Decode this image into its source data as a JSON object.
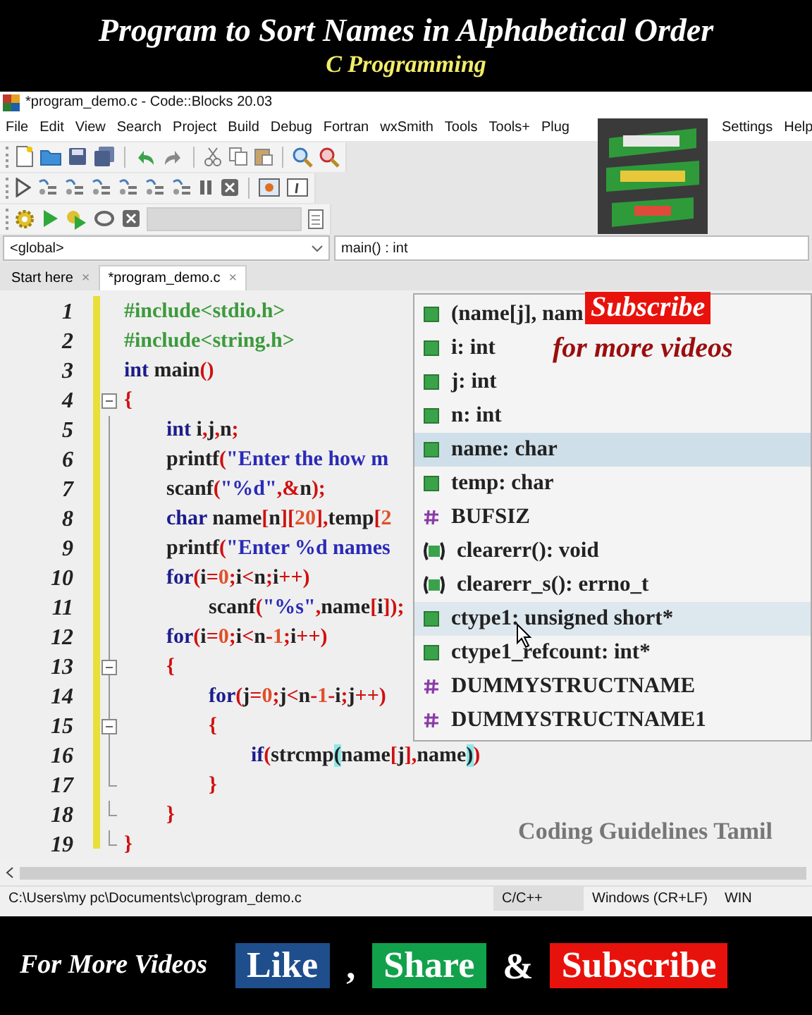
{
  "banner": {
    "title": "Program to Sort Names in Alphabetical Order",
    "subtitle": "C Programming"
  },
  "window": {
    "title": "*program_demo.c - Code::Blocks 20.03",
    "menu": [
      "File",
      "Edit",
      "View",
      "Search",
      "Project",
      "Build",
      "Debug",
      "Fortran",
      "wxSmith",
      "Tools",
      "Tools+",
      "Plug",
      "Settings",
      "Help"
    ],
    "scope": {
      "left": "<global>",
      "right": "main() : int"
    },
    "tabs": [
      {
        "label": "Start here",
        "close": "×",
        "selected": false
      },
      {
        "label": "*program_demo.c",
        "close": "×",
        "selected": true
      }
    ],
    "editor": {
      "lines": [
        {
          "number": "1",
          "kind": "plain",
          "tokens": [
            {
              "kind": "pre",
              "text": "#include<stdio.h>"
            }
          ]
        },
        {
          "number": "2",
          "kind": "plain",
          "tokens": [
            {
              "kind": "pre",
              "text": "#include<string.h>"
            }
          ]
        },
        {
          "number": "3",
          "kind": "plain",
          "tokens": [
            {
              "kind": "kw",
              "text": "int"
            },
            {
              "kind": "id",
              "text": " main"
            },
            {
              "kind": "op",
              "text": "()"
            }
          ]
        },
        {
          "number": "4",
          "kind": "fold_start",
          "tokens": [
            {
              "kind": "op",
              "text": "{"
            }
          ]
        },
        {
          "number": "5",
          "kind": "plain",
          "tokens": [
            {
              "kind": "kw",
              "text": "\tint"
            },
            {
              "kind": "id",
              "text": " i"
            },
            {
              "kind": "op",
              "text": ","
            },
            {
              "kind": "id",
              "text": "j"
            },
            {
              "kind": "op",
              "text": ","
            },
            {
              "kind": "id",
              "text": "n"
            },
            {
              "kind": "op",
              "text": ";"
            }
          ]
        },
        {
          "number": "6",
          "kind": "plain",
          "tokens": [
            {
              "kind": "id",
              "text": "\tprintf"
            },
            {
              "kind": "op",
              "text": "("
            },
            {
              "kind": "str",
              "text": "\"Enter the how m"
            }
          ]
        },
        {
          "number": "7",
          "kind": "plain",
          "tokens": [
            {
              "kind": "id",
              "text": "\tscanf"
            },
            {
              "kind": "op",
              "text": "("
            },
            {
              "kind": "str",
              "text": "\"%d\""
            },
            {
              "kind": "op",
              "text": ",&"
            },
            {
              "kind": "id",
              "text": "n"
            },
            {
              "kind": "op",
              "text": ");"
            }
          ]
        },
        {
          "number": "8",
          "kind": "plain",
          "tokens": [
            {
              "kind": "kw",
              "text": "\tchar"
            },
            {
              "kind": "id",
              "text": " name"
            },
            {
              "kind": "op",
              "text": "["
            },
            {
              "kind": "id",
              "text": "n"
            },
            {
              "kind": "op",
              "text": "]["
            },
            {
              "kind": "num",
              "text": "20"
            },
            {
              "kind": "op",
              "text": "],"
            },
            {
              "kind": "id",
              "text": "temp"
            },
            {
              "kind": "op",
              "text": "["
            },
            {
              "kind": "num",
              "text": "2"
            }
          ]
        },
        {
          "number": "9",
          "kind": "plain",
          "tokens": [
            {
              "kind": "id",
              "text": "\tprintf"
            },
            {
              "kind": "op",
              "text": "("
            },
            {
              "kind": "str",
              "text": "\"Enter %d names"
            }
          ]
        },
        {
          "number": "10",
          "kind": "plain",
          "tokens": [
            {
              "kind": "kw",
              "text": "\tfor"
            },
            {
              "kind": "op",
              "text": "("
            },
            {
              "kind": "id",
              "text": "i"
            },
            {
              "kind": "op",
              "text": "="
            },
            {
              "kind": "num",
              "text": "0"
            },
            {
              "kind": "op",
              "text": ";"
            },
            {
              "kind": "id",
              "text": "i"
            },
            {
              "kind": "op",
              "text": "<"
            },
            {
              "kind": "id",
              "text": "n"
            },
            {
              "kind": "op",
              "text": ";"
            },
            {
              "kind": "id",
              "text": "i"
            },
            {
              "kind": "op",
              "text": "++)"
            }
          ]
        },
        {
          "number": "11",
          "kind": "plain",
          "tokens": [
            {
              "kind": "id",
              "text": "\t\tscanf"
            },
            {
              "kind": "op",
              "text": "("
            },
            {
              "kind": "str",
              "text": "\"%s\""
            },
            {
              "kind": "op",
              "text": ","
            },
            {
              "kind": "id",
              "text": "name"
            },
            {
              "kind": "op",
              "text": "["
            },
            {
              "kind": "id",
              "text": "i"
            },
            {
              "kind": "op",
              "text": "]);"
            }
          ]
        },
        {
          "number": "12",
          "kind": "plain",
          "tokens": [
            {
              "kind": "kw",
              "text": "\tfor"
            },
            {
              "kind": "op",
              "text": "("
            },
            {
              "kind": "id",
              "text": "i"
            },
            {
              "kind": "op",
              "text": "="
            },
            {
              "kind": "num",
              "text": "0"
            },
            {
              "kind": "op",
              "text": ";"
            },
            {
              "kind": "id",
              "text": "i"
            },
            {
              "kind": "op",
              "text": "<"
            },
            {
              "kind": "id",
              "text": "n"
            },
            {
              "kind": "op",
              "text": "-"
            },
            {
              "kind": "num",
              "text": "1"
            },
            {
              "kind": "op",
              "text": ";"
            },
            {
              "kind": "id",
              "text": "i"
            },
            {
              "kind": "op",
              "text": "++)"
            }
          ]
        },
        {
          "number": "13",
          "kind": "fold_start",
          "tokens": [
            {
              "kind": "op",
              "text": "\t{"
            }
          ]
        },
        {
          "number": "14",
          "kind": "plain",
          "tokens": [
            {
              "kind": "kw",
              "text": "\t\tfor"
            },
            {
              "kind": "op",
              "text": "("
            },
            {
              "kind": "id",
              "text": "j"
            },
            {
              "kind": "op",
              "text": "="
            },
            {
              "kind": "num",
              "text": "0"
            },
            {
              "kind": "op",
              "text": ";"
            },
            {
              "kind": "id",
              "text": "j"
            },
            {
              "kind": "op",
              "text": "<"
            },
            {
              "kind": "id",
              "text": "n"
            },
            {
              "kind": "op",
              "text": "-"
            },
            {
              "kind": "num",
              "text": "1"
            },
            {
              "kind": "op",
              "text": "-"
            },
            {
              "kind": "id",
              "text": "i"
            },
            {
              "kind": "op",
              "text": ";"
            },
            {
              "kind": "id",
              "text": "j"
            },
            {
              "kind": "op",
              "text": "++)"
            }
          ]
        },
        {
          "number": "15",
          "kind": "fold_start",
          "tokens": [
            {
              "kind": "op",
              "text": "\t\t{"
            }
          ]
        },
        {
          "number": "16",
          "kind": "plain",
          "tokens": [
            {
              "kind": "kw",
              "text": "\t\t\tif"
            },
            {
              "kind": "op",
              "text": "("
            },
            {
              "kind": "id",
              "text": "strcmp"
            },
            {
              "kind": "match",
              "text": "("
            },
            {
              "kind": "id",
              "text": "name"
            },
            {
              "kind": "op",
              "text": "["
            },
            {
              "kind": "id",
              "text": "j"
            },
            {
              "kind": "op",
              "text": "],"
            },
            {
              "kind": "id",
              "text": "name"
            },
            {
              "kind": "match",
              "text": ")"
            },
            {
              "kind": "op",
              "text": ")"
            }
          ]
        },
        {
          "number": "17",
          "kind": "fold_end",
          "tokens": [
            {
              "kind": "op",
              "text": "\t\t}"
            }
          ]
        },
        {
          "number": "18",
          "kind": "fold_end",
          "tokens": [
            {
              "kind": "op",
              "text": "\t}"
            }
          ]
        },
        {
          "number": "19",
          "kind": "fold_end",
          "tokens": [
            {
              "kind": "op",
              "text": "}"
            }
          ]
        }
      ],
      "caption": "Coding Guidelines Tamil"
    },
    "autocomplete": {
      "items": [
        {
          "kind": "variable",
          "label": "(name[j], nam",
          "selected": false,
          "hovered": false
        },
        {
          "kind": "variable",
          "label": "i: int",
          "selected": false,
          "hovered": false
        },
        {
          "kind": "variable",
          "label": "j: int",
          "selected": false,
          "hovered": false
        },
        {
          "kind": "variable",
          "label": "n: int",
          "selected": false,
          "hovered": false
        },
        {
          "kind": "variable",
          "label": "name: char",
          "selected": true,
          "hovered": false
        },
        {
          "kind": "variable",
          "label": "temp: char",
          "selected": false,
          "hovered": false
        },
        {
          "kind": "macro",
          "label": "BUFSIZ",
          "selected": false,
          "hovered": false
        },
        {
          "kind": "function",
          "label": "clearerr(): void",
          "selected": false,
          "hovered": false
        },
        {
          "kind": "function",
          "label": "clearerr_s(): errno_t",
          "selected": false,
          "hovered": false
        },
        {
          "kind": "variable",
          "label": "ctype1: unsigned short*",
          "selected": false,
          "hovered": true
        },
        {
          "kind": "variable",
          "label": "ctype1_refcount: int*",
          "selected": false,
          "hovered": false
        },
        {
          "kind": "macro",
          "label": "DUMMYSTRUCTNAME",
          "selected": false,
          "hovered": false
        },
        {
          "kind": "macro",
          "label": "DUMMYSTRUCTNAME1",
          "selected": false,
          "hovered": false
        }
      ]
    },
    "status_bar": [
      "C:\\Users\\my pc\\Documents\\c\\program_demo.c",
      "C/C++",
      "Windows (CR+LF)",
      "WIN"
    ]
  },
  "overlay": {
    "subscribe": "Subscribe",
    "more_videos": "for more videos"
  },
  "footer": [
    {
      "kind": "text",
      "label": "For More Videos"
    },
    {
      "kind": "button",
      "label": "Like",
      "color": "#1f4e8c"
    },
    {
      "kind": "sep",
      "label": ","
    },
    {
      "kind": "button",
      "label": "Share",
      "color": "#12a14b"
    },
    {
      "kind": "sep",
      "label": "&"
    },
    {
      "kind": "button",
      "label": "Subscribe",
      "color": "#e8120c"
    }
  ]
}
